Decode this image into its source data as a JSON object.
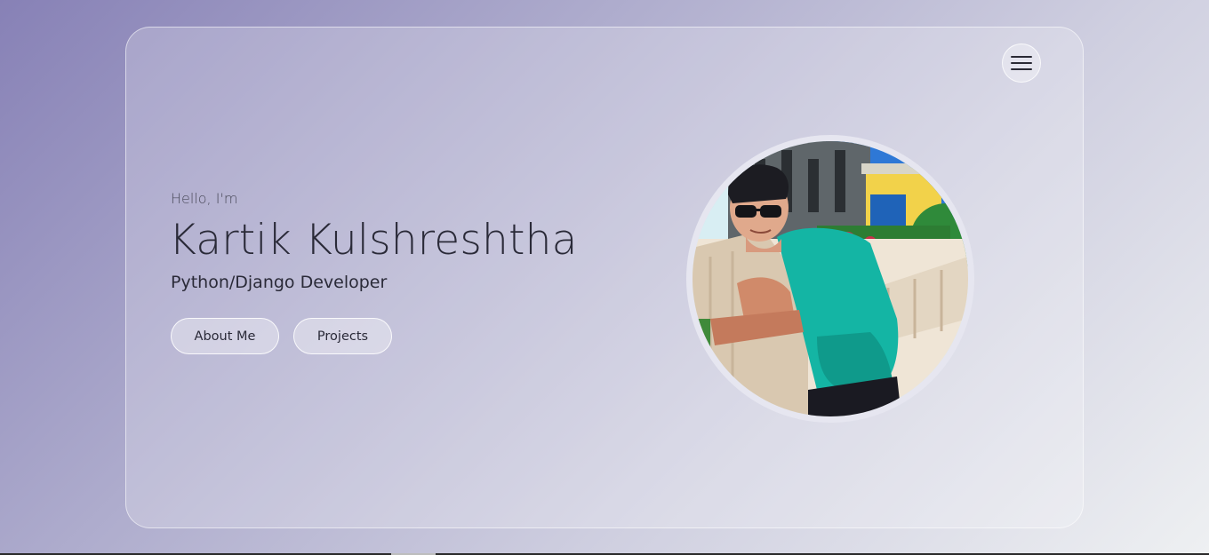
{
  "hero": {
    "greeting": "Hello, I'm",
    "name": "Kartik Kulshreshtha",
    "role": "Python/Django Developer"
  },
  "buttons": {
    "about": "About Me",
    "projects": "Projects"
  },
  "icons": {
    "menu": "hamburger-menu-icon",
    "avatar": "profile-photo"
  },
  "colors": {
    "text_dark": "#2a2a38",
    "card_border": "#ffffff",
    "avatar_ring": "#e6e6f0"
  }
}
